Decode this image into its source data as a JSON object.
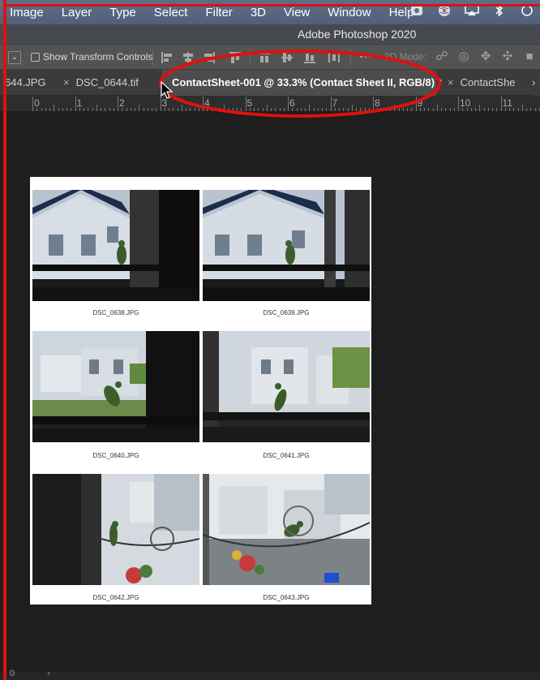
{
  "menubar": {
    "items": [
      "Image",
      "Layer",
      "Type",
      "Select",
      "Filter",
      "3D",
      "View",
      "Window",
      "Help"
    ],
    "tray_icons": [
      "creative-cloud-icon",
      "globe-icon",
      "airplay-icon",
      "bluetooth-icon",
      "time-machine-icon"
    ]
  },
  "titlebar": {
    "title": "Adobe Photoshop 2020"
  },
  "optionsbar": {
    "show_transform_controls": "Show Transform Controls",
    "mode_label": "3D Mode:"
  },
  "tabs": [
    {
      "label": "644.JPG",
      "close": ""
    },
    {
      "label": "DSC_0644.tif",
      "close": "×"
    },
    {
      "label": "ContactSheet-001 @ 33.3% (Contact Sheet II, RGB/8) *",
      "close": ""
    },
    {
      "label": "ContactShe",
      "close": "×"
    }
  ],
  "tabs_more": "›",
  "ruler": {
    "numbers": [
      "0",
      "1",
      "2",
      "3",
      "4",
      "5",
      "6",
      "7",
      "8",
      "9",
      "10",
      "11"
    ]
  },
  "contact_sheet": {
    "thumbnails": [
      {
        "label": "DSC_0638.JPG"
      },
      {
        "label": "DSC_0639.JPG"
      },
      {
        "label": "DSC_0640.JPG"
      },
      {
        "label": "DSC_0641.JPG"
      },
      {
        "label": "DSC_0642.JPG"
      },
      {
        "label": "DSC_0643.JPG"
      }
    ]
  },
  "statusbar": {
    "left": "0",
    "arrow": "›"
  },
  "colors": {
    "annotation_red": "#e01010",
    "menubar_blue": "#5a6b85",
    "canvas_bg": "#1e1e1e"
  }
}
